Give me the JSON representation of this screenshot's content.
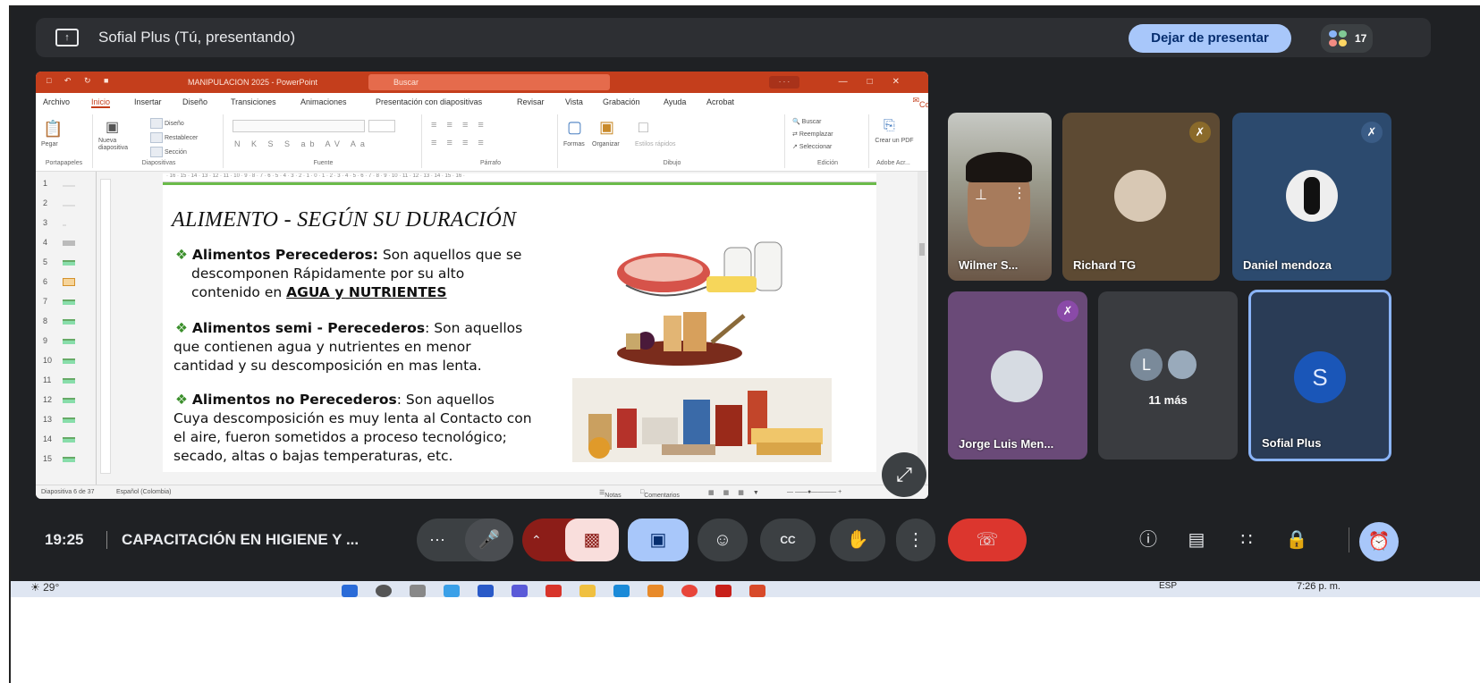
{
  "topbar": {
    "present_icon": "present-screen-icon",
    "title": "Sofial Plus (Tú, presentando)",
    "stop_button": "Dejar de presentar",
    "people_count": "17"
  },
  "powerpoint": {
    "window_title": "MANIPULACION 2025 - PowerPoint",
    "search_placeholder": "Buscar",
    "menu": [
      "Archivo",
      "Inicio",
      "Insertar",
      "Diseño",
      "Transiciones",
      "Animaciones",
      "Presentación con diapositivas",
      "Revisar",
      "Vista",
      "Grabación",
      "Ayuda",
      "Acrobat"
    ],
    "share_label": "Compartir",
    "ribbon_groups": [
      "Portapapeles",
      "Diapositivas",
      "Fuente",
      "Párrafo",
      "Dibujo",
      "Edición",
      "Adobe Acr..."
    ],
    "ribbon_buttons": {
      "paste": "Pegar",
      "new_slide": "Nueva diapositiva",
      "layout": "Diseño",
      "reset": "Restablecer",
      "section": "Sección",
      "shapes": "Formas",
      "arrange": "Organizar",
      "styles": "Estilos rápidos",
      "find": "Buscar",
      "replace": "Reemplazar",
      "select": "Seleccionar",
      "create_pdf": "Crear un PDF"
    },
    "slide_numbers": [
      "1",
      "2",
      "3",
      "4",
      "5",
      "6",
      "7",
      "8",
      "9",
      "10",
      "11",
      "12",
      "13",
      "14",
      "15"
    ],
    "status": {
      "slide_info": "Diapositiva 6 de 37",
      "language": "Español (Colombia)",
      "notes": "Notas",
      "comments": "Comentarios"
    }
  },
  "slide": {
    "title": "ALIMENTO - SEGÚN SU DURACIÓN",
    "bullet1_bold": "Alimentos Perecederos:",
    "bullet1_text_a": " Son aquellos que se",
    "bullet1_line2": "descomponen Rápidamente por su alto",
    "bullet1_line3_a": "contenido en ",
    "bullet1_line3_u": "AGUA y NUTRIENTES",
    "bullet2_bold": "Alimentos semi - Perecederos",
    "bullet2_text_a": ":  Son aquellos",
    "bullet2_line2": "que contienen agua y nutrientes en menor",
    "bullet2_line3": "cantidad y su descomposición en mas lenta.",
    "bullet3_bold": "Alimentos no Perecederos",
    "bullet3_text_a": ": Son aquellos",
    "bullet3_line2": "Cuya descomposición es muy lenta al Contacto con",
    "bullet3_line3": "el aire, fueron sometidos a proceso tecnológico;",
    "bullet3_line4": "secado, altas o bajas temperaturas, etc."
  },
  "participants": [
    {
      "name": "Wilmer S..."
    },
    {
      "name": "Richard TG"
    },
    {
      "name": "Daniel mendoza"
    },
    {
      "name": "Jorge Luis Men..."
    },
    {
      "name": "11 más",
      "initial": "L"
    },
    {
      "name": "Sofial Plus",
      "initial": "S"
    }
  ],
  "bottombar": {
    "time": "19:25",
    "meeting_title": "CAPACITACIÓN EN HIGIENE Y ..."
  },
  "taskbar": {
    "weather": "29°",
    "language": "ESP",
    "clock": "7:26 p. m."
  },
  "colors": {
    "meet_bg": "#1f2124",
    "accent_blue": "#a8c7fa",
    "leave_red": "#dc362e",
    "ppt_orange": "#c43e1c"
  }
}
